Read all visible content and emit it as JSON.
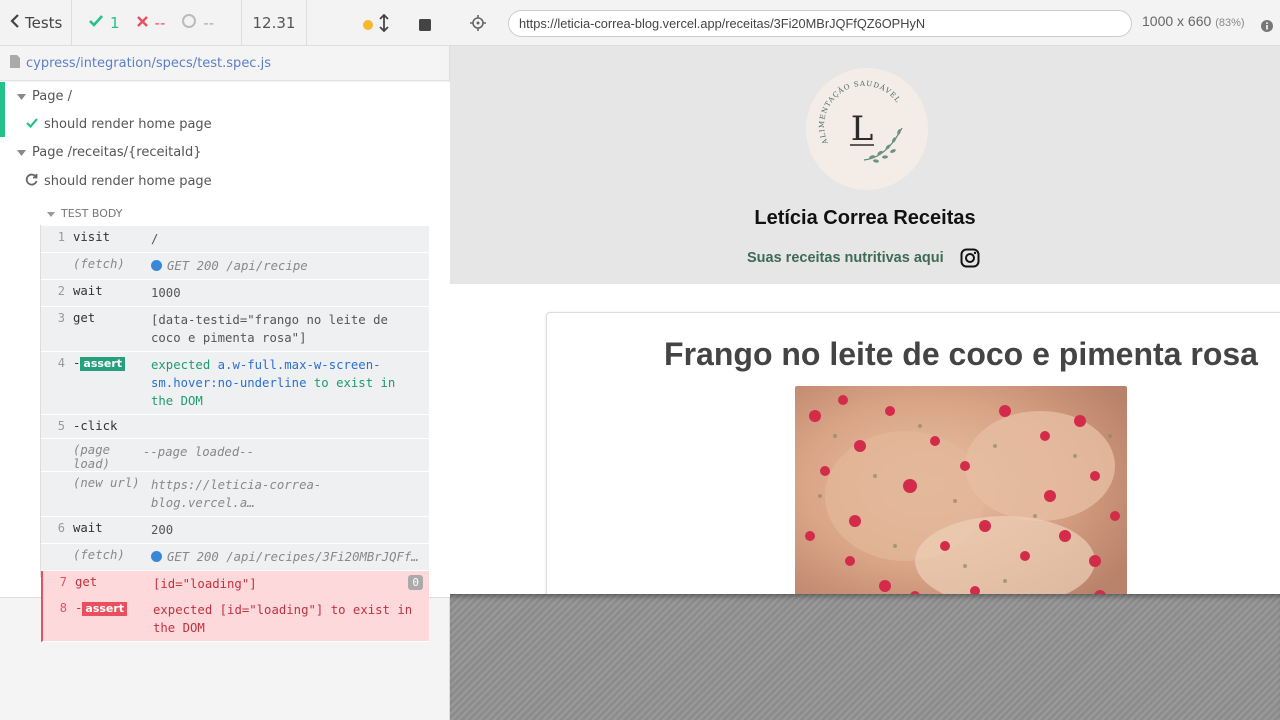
{
  "runner": {
    "back_label": "Tests",
    "passed_count": "1",
    "failed_count": "--",
    "pending_count": "--",
    "duration": "12.31",
    "spec_path": "cypress/integration/specs/test.spec.js",
    "suites": [
      {
        "title": "Page /",
        "test": "should render home page"
      },
      {
        "title": "Page /receitas/{receitaId}",
        "test": "should render home page"
      }
    ],
    "test_body_label": "TEST BODY",
    "commands": [
      {
        "num": "1",
        "name": "visit",
        "msg": "/"
      },
      {
        "num": "",
        "name": "(fetch)",
        "msg": "GET 200 /api/recipe"
      },
      {
        "num": "2",
        "name": "wait",
        "msg": "1000"
      },
      {
        "num": "3",
        "name": "get",
        "msg": "[data-testid=\"frango no leite de coco e pimenta rosa\"]"
      },
      {
        "num": "4",
        "name": "assert",
        "msg_prefix": "expected",
        "msg_selector": "a.w-full.max-w-screen-sm.hover:no-underline",
        "msg_suffix": "to exist in the DOM"
      },
      {
        "num": "5",
        "name": "-click",
        "msg": ""
      },
      {
        "num": "",
        "name": "(page load)",
        "msg": "--page loaded--"
      },
      {
        "num": "",
        "name": "(new url)",
        "msg": "https://leticia-correa-blog.vercel.a…"
      },
      {
        "num": "6",
        "name": "wait",
        "msg": "200"
      },
      {
        "num": "",
        "name": "(fetch)",
        "msg": "GET 200 /api/recipes/3Fi20MBrJQFf…"
      },
      {
        "num": "7",
        "name": "get",
        "msg": "[id=\"loading\"]",
        "tag": "0"
      },
      {
        "num": "8",
        "name": "assert",
        "msg_prefix": "expected",
        "msg_selector": "[id=\"loading\"]",
        "msg_suffix": "to exist in the DOM"
      }
    ]
  },
  "browser": {
    "url": "https://leticia-correa-blog.vercel.app/receitas/3Fi20MBrJQFfQZ6OPHyN",
    "viewport": "1000 x 660",
    "zoom": "(83%)"
  },
  "site": {
    "logo_letter": "L",
    "logo_ring_text": "ALIMENTAÇÃO SAUDÁVEL",
    "title": "Letícia Correa Receitas",
    "subtitle": "Suas receitas nutritivas aqui",
    "recipe_title": "Frango no leite de coco e pimenta rosa"
  },
  "colors": {
    "pass": "#25c18b",
    "fail": "#e94f5c",
    "accent_link": "#5b7fc7",
    "subtitle_green": "#3d6b55"
  }
}
